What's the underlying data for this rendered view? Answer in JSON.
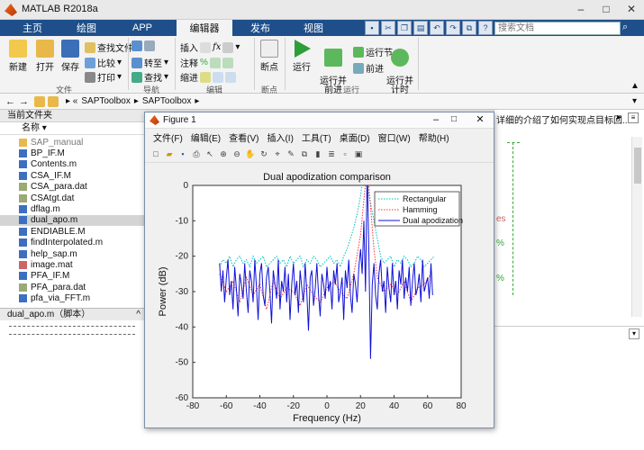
{
  "app": {
    "title": "MATLAB R2018a"
  },
  "tabs": [
    "主页",
    "绘图",
    "APP",
    "编辑器",
    "发布",
    "视图"
  ],
  "search": {
    "placeholder": "搜索文档"
  },
  "ribbon": {
    "new": "新建",
    "open": "打开",
    "save": "保存",
    "find_files": "查找文件",
    "compare": "比较",
    "print": "打印",
    "goto": "转至",
    "find": "查找",
    "insert": "插入",
    "comment": "注释",
    "indent": "缩进",
    "breakpoint": "断点",
    "run": "运行",
    "run_advance": "运行并\n前进",
    "run_section": "运行节",
    "advance": "前进",
    "run_time": "运行并\n计时",
    "groups": [
      "文件",
      "导航",
      "编辑",
      "断点",
      "运行"
    ]
  },
  "address": {
    "path1": "SAPToolbox",
    "path2": "SAPToolbox"
  },
  "left": {
    "header": "当前文件夹",
    "name_col": "名称",
    "files": [
      "SAP_manual",
      "BP_IF.M",
      "Contents.m",
      "CSA_IF.M",
      "CSA_para.dat",
      "CSAtgt.dat",
      "dflag.m",
      "dual_apo.m",
      "ENDIABLE.M",
      "findInterpolated.m",
      "help_sap.m",
      "image.mat",
      "PFA_IF.M",
      "PFA_para.dat",
      "pfa_via_FFT.m"
    ],
    "selected_index": 7,
    "details_title": "dual_apo.m（脚本）"
  },
  "editor": {
    "hint": "详细的介绍了如何实现点目标回..."
  },
  "figure": {
    "window_title": "Figure 1",
    "menus": [
      "文件(F)",
      "编辑(E)",
      "查看(V)",
      "插入(I)",
      "工具(T)",
      "桌面(D)",
      "窗口(W)",
      "帮助(H)"
    ]
  },
  "chart_data": {
    "type": "line",
    "title": "Dual apodization comparison",
    "xlabel": "Frequency (Hz)",
    "ylabel": "Power (dB)",
    "xlim": [
      -80,
      80
    ],
    "ylim": [
      -60,
      0
    ],
    "xticks": [
      -80,
      -60,
      -40,
      -20,
      0,
      20,
      40,
      60,
      80
    ],
    "yticks": [
      0,
      -10,
      -20,
      -30,
      -40,
      -50,
      -60
    ],
    "legend": "top-right",
    "grid": false,
    "series": [
      {
        "name": "Rectangular",
        "style": "dotted",
        "color": "#00bfbf",
        "x": [
          -64,
          -62,
          -60,
          -58,
          -56,
          -54,
          -52,
          -50,
          -48,
          -46,
          -44,
          -42,
          -40,
          -38,
          -36,
          -34,
          -32,
          -30,
          -28,
          -26,
          -24,
          -22,
          -20,
          -18,
          -16,
          -14,
          -12,
          -10,
          -8,
          -6,
          -4,
          -2,
          0,
          2,
          4,
          6,
          8,
          10,
          12,
          14,
          16,
          18,
          20,
          22,
          24,
          26,
          28,
          30,
          32,
          34,
          36,
          38,
          40,
          42,
          44,
          46,
          48,
          50,
          52,
          54,
          56,
          58,
          60,
          62,
          64
        ],
        "y": [
          -23,
          -21,
          -22,
          -20,
          -23,
          -21,
          -20,
          -22,
          -21,
          -23,
          -20,
          -22,
          -21,
          -20,
          -23,
          -22,
          -21,
          -20,
          -22,
          -21,
          -23,
          -20,
          -22,
          -21,
          -20,
          -23,
          -21,
          -22,
          -20,
          -21,
          -23,
          -22,
          -21,
          -20,
          -22,
          -21,
          -23,
          -20,
          -18,
          -15,
          -12,
          -8,
          -3,
          5,
          0,
          -5,
          -10,
          -15,
          -20,
          -22,
          -21,
          -20,
          -23,
          -21,
          -22,
          -20,
          -21,
          -23,
          -22,
          -20,
          -21,
          -23,
          -22,
          -21,
          -20
        ]
      },
      {
        "name": "Hamming",
        "style": "dotted",
        "color": "#ff3030",
        "x": [
          -64,
          -60,
          -56,
          -52,
          -48,
          -44,
          -40,
          -36,
          -32,
          -28,
          -24,
          -20,
          -16,
          -12,
          -8,
          -4,
          0,
          4,
          8,
          12,
          16,
          20,
          22,
          24,
          26,
          28,
          30,
          34,
          38,
          42,
          46,
          50,
          54,
          58,
          62
        ],
        "y": [
          -25,
          -30,
          -27,
          -33,
          -26,
          -31,
          -28,
          -35,
          -27,
          -32,
          -29,
          -30,
          -34,
          -28,
          -31,
          -33,
          -29,
          -27,
          -30,
          -32,
          -25,
          -14,
          -4,
          5,
          -6,
          -18,
          -26,
          -30,
          -28,
          -31,
          -27,
          -33,
          -29,
          -28,
          -25
        ]
      },
      {
        "name": "Dual apodization",
        "style": "solid",
        "color": "#1010d8",
        "x": [
          -64,
          -63,
          -62,
          -61,
          -60,
          -59,
          -58,
          -57,
          -56,
          -55,
          -54,
          -53,
          -52,
          -51,
          -50,
          -49,
          -48,
          -47,
          -46,
          -45,
          -44,
          -43,
          -42,
          -41,
          -40,
          -39,
          -38,
          -37,
          -36,
          -35,
          -34,
          -33,
          -32,
          -31,
          -30,
          -29,
          -28,
          -27,
          -26,
          -25,
          -24,
          -23,
          -22,
          -21,
          -20,
          -19,
          -18,
          -17,
          -16,
          -15,
          -14,
          -13,
          -12,
          -11,
          -10,
          -9,
          -8,
          -7,
          -6,
          -5,
          -4,
          -3,
          -2,
          -1,
          0,
          1,
          2,
          3,
          4,
          5,
          6,
          7,
          8,
          9,
          10,
          11,
          12,
          13,
          14,
          15,
          16,
          17,
          18,
          19,
          20,
          21,
          22,
          23,
          24,
          25,
          26,
          27,
          28,
          29,
          30,
          31,
          32,
          33,
          34,
          35,
          36,
          37,
          38,
          39,
          40,
          41,
          42,
          43,
          44,
          45,
          46,
          47,
          48,
          49,
          50,
          51,
          52,
          53,
          54,
          55,
          56,
          57,
          58,
          59,
          60,
          61,
          62,
          63
        ],
        "y": [
          -22,
          -30,
          -24,
          -33,
          -26,
          -21,
          -31,
          -27,
          -35,
          -23,
          -29,
          -37,
          -25,
          -28,
          -32,
          -22,
          -30,
          -36,
          -24,
          -27,
          -33,
          -21,
          -29,
          -38,
          -25,
          -22,
          -31,
          -34,
          -26,
          -23,
          -30,
          -39,
          -24,
          -28,
          -32,
          -21,
          -35,
          -27,
          -30,
          -23,
          -33,
          -25,
          -38,
          -28,
          -22,
          -31,
          -27,
          -36,
          -24,
          -29,
          -33,
          -22,
          -30,
          -41,
          -26,
          -24,
          -34,
          -29,
          -22,
          -31,
          -37,
          -25,
          -28,
          -32,
          -23,
          -30,
          -27,
          -35,
          -24,
          -28,
          -22,
          -33,
          -30,
          -26,
          -38,
          -24,
          -29,
          -21,
          -31,
          -36,
          -25,
          -28,
          -33,
          -23,
          -18,
          -25,
          -10,
          -30,
          5,
          -20,
          -49,
          -28,
          -22,
          -31,
          -35,
          -25,
          -21,
          -30,
          -27,
          -36,
          -23,
          -29,
          -33,
          -22,
          -31,
          -27,
          -35,
          -24,
          -28,
          -21,
          -32,
          -26,
          -30,
          -23,
          -34,
          -27,
          -22,
          -31,
          -29,
          -25,
          -33,
          -21,
          -30,
          -28,
          -26,
          -32,
          -22,
          -31
        ]
      }
    ]
  }
}
